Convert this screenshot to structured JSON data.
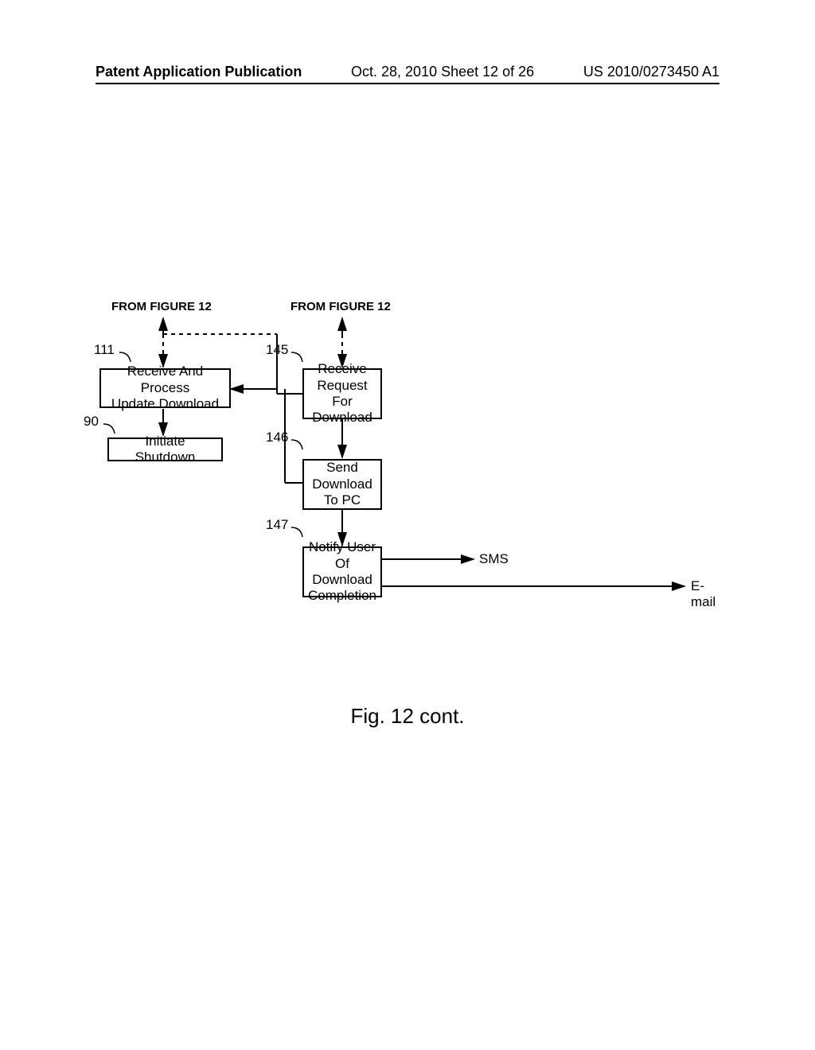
{
  "header": {
    "left": "Patent Application Publication",
    "center": "Oct. 28, 2010  Sheet 12 of 26",
    "right": "US 2010/0273450 A1"
  },
  "labels": {
    "from_left": "FROM FIGURE 12",
    "from_right": "FROM FIGURE 12",
    "ref_111": "111",
    "ref_90": "90",
    "ref_145": "145",
    "ref_146": "146",
    "ref_147": "147",
    "sms": "SMS",
    "email": "E-mail"
  },
  "boxes": {
    "b111": "Receive And Process\nUpdate Download",
    "b90": "Initiate Shutdown",
    "b145": "Receive\nRequest For\nDownload",
    "b146": "Send\nDownload\nTo PC",
    "b147": "Notify User\nOf Download\nCompletion"
  },
  "figure_caption": "Fig. 12 cont."
}
